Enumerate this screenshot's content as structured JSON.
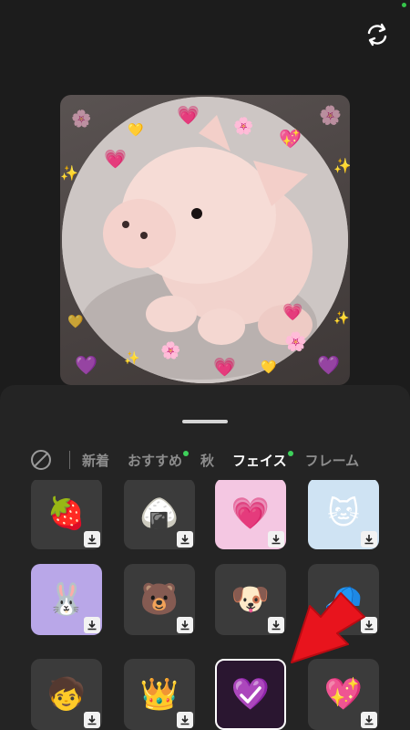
{
  "camera": {
    "flip_icon": "camera-flip-icon"
  },
  "preview": {
    "subject": "pink plush pig with heart & flower stickers"
  },
  "tabs": {
    "none_icon": "no-filter-icon",
    "items": [
      {
        "label": "新着",
        "active": false,
        "dot": false
      },
      {
        "label": "おすすめ",
        "active": false,
        "dot": true
      },
      {
        "label": "秋",
        "active": false,
        "dot": false
      },
      {
        "label": "フェイス",
        "active": true,
        "dot": true
      },
      {
        "label": "フレーム",
        "active": false,
        "dot": false
      }
    ]
  },
  "stickers": [
    {
      "name": "strawberry-hearts",
      "icon": "🍓",
      "bg": "#3b3b3b",
      "downloaded": false,
      "selected": false
    },
    {
      "name": "onigiri-kid",
      "icon": "🍙",
      "bg": "#3b3b3b",
      "downloaded": false,
      "selected": false
    },
    {
      "name": "heart-eye-face",
      "icon": "💗",
      "bg": "#f4c7e2",
      "downloaded": false,
      "selected": false
    },
    {
      "name": "cat-ears-face",
      "icon": "🐱",
      "bg": "#cfe3f3",
      "downloaded": false,
      "selected": false
    },
    {
      "name": "bunny-ears-face",
      "icon": "🐰",
      "bg": "#b9a7e8",
      "downloaded": false,
      "selected": false
    },
    {
      "name": "bear-friends",
      "icon": "🐻",
      "bg": "#3b3b3b",
      "downloaded": false,
      "selected": false
    },
    {
      "name": "puppy-ears",
      "icon": "🐶",
      "bg": "#3b3b3b",
      "downloaded": false,
      "selected": false
    },
    {
      "name": "brown-hair-cap",
      "icon": "🧢",
      "bg": "#3b3b3b",
      "downloaded": true,
      "selected": false
    },
    {
      "name": "beanie-kid",
      "icon": "🧒",
      "bg": "#3b3b3b",
      "downloaded": false,
      "selected": false
    },
    {
      "name": "gold-crown",
      "icon": "👑",
      "bg": "#3b3b3b",
      "downloaded": false,
      "selected": false
    },
    {
      "name": "purple-hearts",
      "icon": "💜",
      "bg": "#2a1630",
      "downloaded": true,
      "selected": true
    },
    {
      "name": "pink-heart-balloon",
      "icon": "💖",
      "bg": "#3b3b3b",
      "downloaded": false,
      "selected": false
    }
  ],
  "colors": {
    "accent_green": "#3ed15b",
    "arrow_red": "#e8141d",
    "sheet_bg": "#242424"
  }
}
